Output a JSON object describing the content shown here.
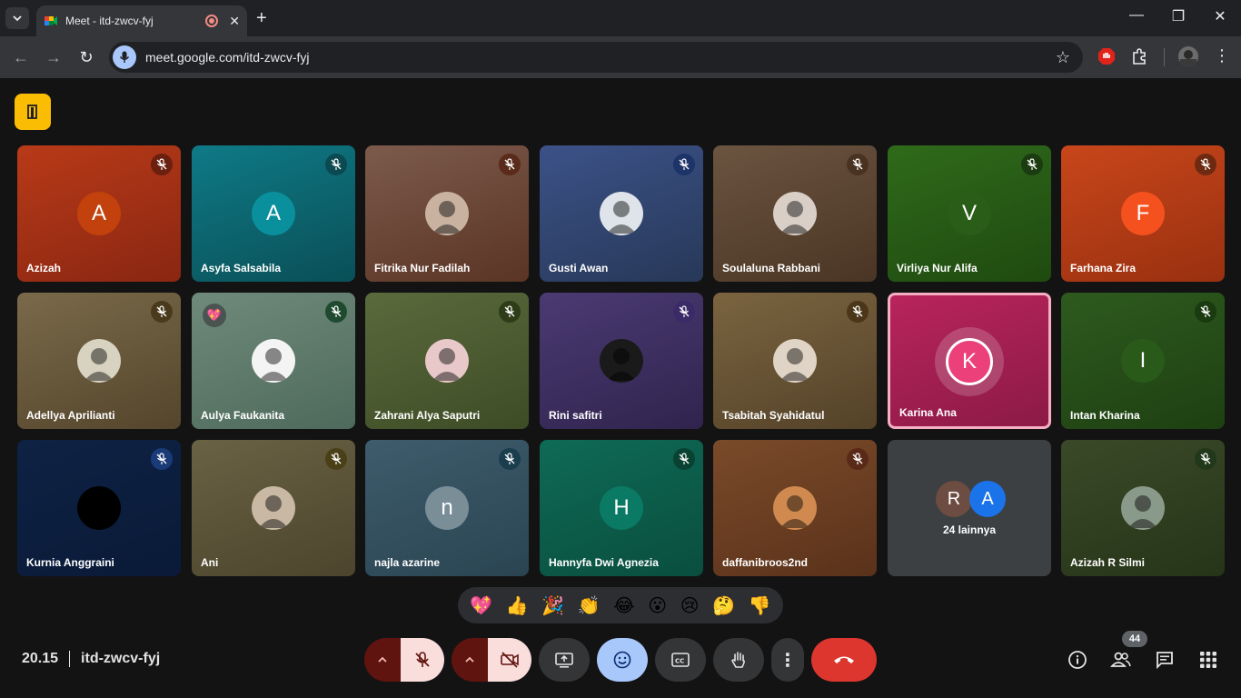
{
  "browser": {
    "tab_title": "Meet - itd-zwcv-fyj",
    "url_host": "meet.google.com",
    "url_path": "/itd-zwcv-fyj"
  },
  "colors": {
    "host_badge": "#fbbc04",
    "end_call": "#dc362e",
    "muted_control_bg": "#f9dedc",
    "emoji_active": "#a8c7fa",
    "speaking_border": "#f6aec3"
  },
  "participants": [
    {
      "name": "Azizah",
      "initial": "A",
      "bg": "linear-gradient(160deg,#b83a18,#8a2612)",
      "avatar_bg": "#c2410c",
      "mic_bg": "#6b1f0e",
      "type": "letter"
    },
    {
      "name": "Asyfa Salsabila",
      "initial": "A",
      "bg": "linear-gradient(160deg,#0e7a86,#0a4f57)",
      "avatar_bg": "#0a8f9c",
      "mic_bg": "#0b4a52",
      "type": "letter"
    },
    {
      "name": "Fitrika Nur Fadilah",
      "initial": "",
      "bg": "linear-gradient(160deg,#7c5a4c,#5a3424)",
      "avatar_bg": "#c9b2a0",
      "mic_bg": "#5a2a1a",
      "type": "photo"
    },
    {
      "name": "Gusti Awan",
      "initial": "",
      "bg": "linear-gradient(160deg,#3c5288,#273858)",
      "avatar_bg": "#dfe3ea",
      "mic_bg": "#1d3468",
      "type": "photo"
    },
    {
      "name": "Soulaluna Rabbani",
      "initial": "",
      "bg": "linear-gradient(160deg,#6b5440,#4a3524)",
      "avatar_bg": "#d9cfc7",
      "mic_bg": "#4a3220",
      "type": "photo"
    },
    {
      "name": "Virliya Nur Alifa",
      "initial": "V",
      "bg": "linear-gradient(160deg,#2f6a1a,#1f4a10)",
      "avatar_bg": "#2a5e18",
      "mic_bg": "#1b3c10",
      "type": "letter"
    },
    {
      "name": "Farhana Zira",
      "initial": "F",
      "bg": "linear-gradient(160deg,#c8461a,#993010)",
      "avatar_bg": "#f4511e",
      "mic_bg": "#6e2a10",
      "type": "letter"
    },
    {
      "name": "Adellya Aprilianti",
      "initial": "",
      "bg": "linear-gradient(160deg,#7a6a4a,#54452c)",
      "avatar_bg": "#d8d2c0",
      "mic_bg": "#4a3a1c",
      "type": "photo"
    },
    {
      "name": "Aulya Faukanita",
      "initial": "",
      "bg": "linear-gradient(160deg,#6f8a7a,#4e6a5c)",
      "avatar_bg": "#f4f4f4",
      "mic_bg": "#1e4a30",
      "type": "photo",
      "reaction": "💖"
    },
    {
      "name": "Zahrani Alya Saputri",
      "initial": "",
      "bg": "linear-gradient(160deg,#5a6a3c,#3e4c26)",
      "avatar_bg": "#e8c8c8",
      "mic_bg": "#2e3c18",
      "type": "photo"
    },
    {
      "name": "Rini safitri",
      "initial": "",
      "bg": "linear-gradient(160deg,#4a3a72,#30244e)",
      "avatar_bg": "#1a1a1a",
      "mic_bg": "#3a2a68",
      "type": "photo"
    },
    {
      "name": "Tsabitah Syahidatul",
      "initial": "",
      "bg": "linear-gradient(160deg,#7a6440,#544228)",
      "avatar_bg": "#e0d4c6",
      "mic_bg": "#4a3618",
      "type": "photo"
    },
    {
      "name": "Karina Ana",
      "initial": "K",
      "bg": "linear-gradient(160deg,#b8245c,#8c1a46)",
      "avatar_bg": "#ec407a",
      "mic_bg": "",
      "type": "speaking"
    },
    {
      "name": "Intan Kharina",
      "initial": "I",
      "bg": "linear-gradient(160deg,#2e5a1e,#1e4012)",
      "avatar_bg": "#2a5a1a",
      "mic_bg": "#1a3a10",
      "type": "letter"
    },
    {
      "name": "Kurnia Anggraini",
      "initial": "",
      "bg": "linear-gradient(160deg,#0e2244,#0a1a38)",
      "avatar_bg": "#000000",
      "mic_bg": "#1a3a78",
      "type": "photo"
    },
    {
      "name": "Ani",
      "initial": "",
      "bg": "linear-gradient(160deg,#6a6244,#4c442c)",
      "avatar_bg": "#c8b8a4",
      "mic_bg": "#4a4018",
      "type": "photo"
    },
    {
      "name": "najla azarine",
      "initial": "n",
      "bg": "linear-gradient(160deg,#3e5c6c,#2a4452)",
      "avatar_bg": "#7a8e98",
      "mic_bg": "#1a3e4e",
      "type": "letter"
    },
    {
      "name": "Hannyfa Dwi Agnezia",
      "initial": "H",
      "bg": "linear-gradient(160deg,#0e6a56,#0a4e3e)",
      "avatar_bg": "#0b7a64",
      "mic_bg": "#0a4232",
      "type": "letter"
    },
    {
      "name": "daffanibroos2nd",
      "initial": "",
      "bg": "linear-gradient(160deg,#7a4a2a,#5a321a)",
      "avatar_bg": "#d08a50",
      "mic_bg": "#5a2a18",
      "type": "photo"
    },
    {
      "name": "",
      "initial": "",
      "bg": "#3c4043",
      "avatar_bg": "",
      "mic_bg": "",
      "type": "others"
    },
    {
      "name": "Azizah R Silmi",
      "initial": "",
      "bg": "linear-gradient(160deg,#3a4a28,#263418)",
      "avatar_bg": "#8a9a8a",
      "mic_bg": "#22381a",
      "type": "photo"
    }
  ],
  "others_tile": {
    "avatars": [
      {
        "initial": "R",
        "bg": "#6d4c41"
      },
      {
        "initial": "A",
        "bg": "#1a73e8"
      }
    ],
    "label": "24 lainnya"
  },
  "reactions": [
    "💖",
    "👍",
    "🎉",
    "👏",
    "😂",
    "😮",
    "😢",
    "🤔",
    "👎"
  ],
  "meeting": {
    "time": "20.15",
    "code": "itd-zwcv-fyj",
    "participant_count": "44"
  }
}
